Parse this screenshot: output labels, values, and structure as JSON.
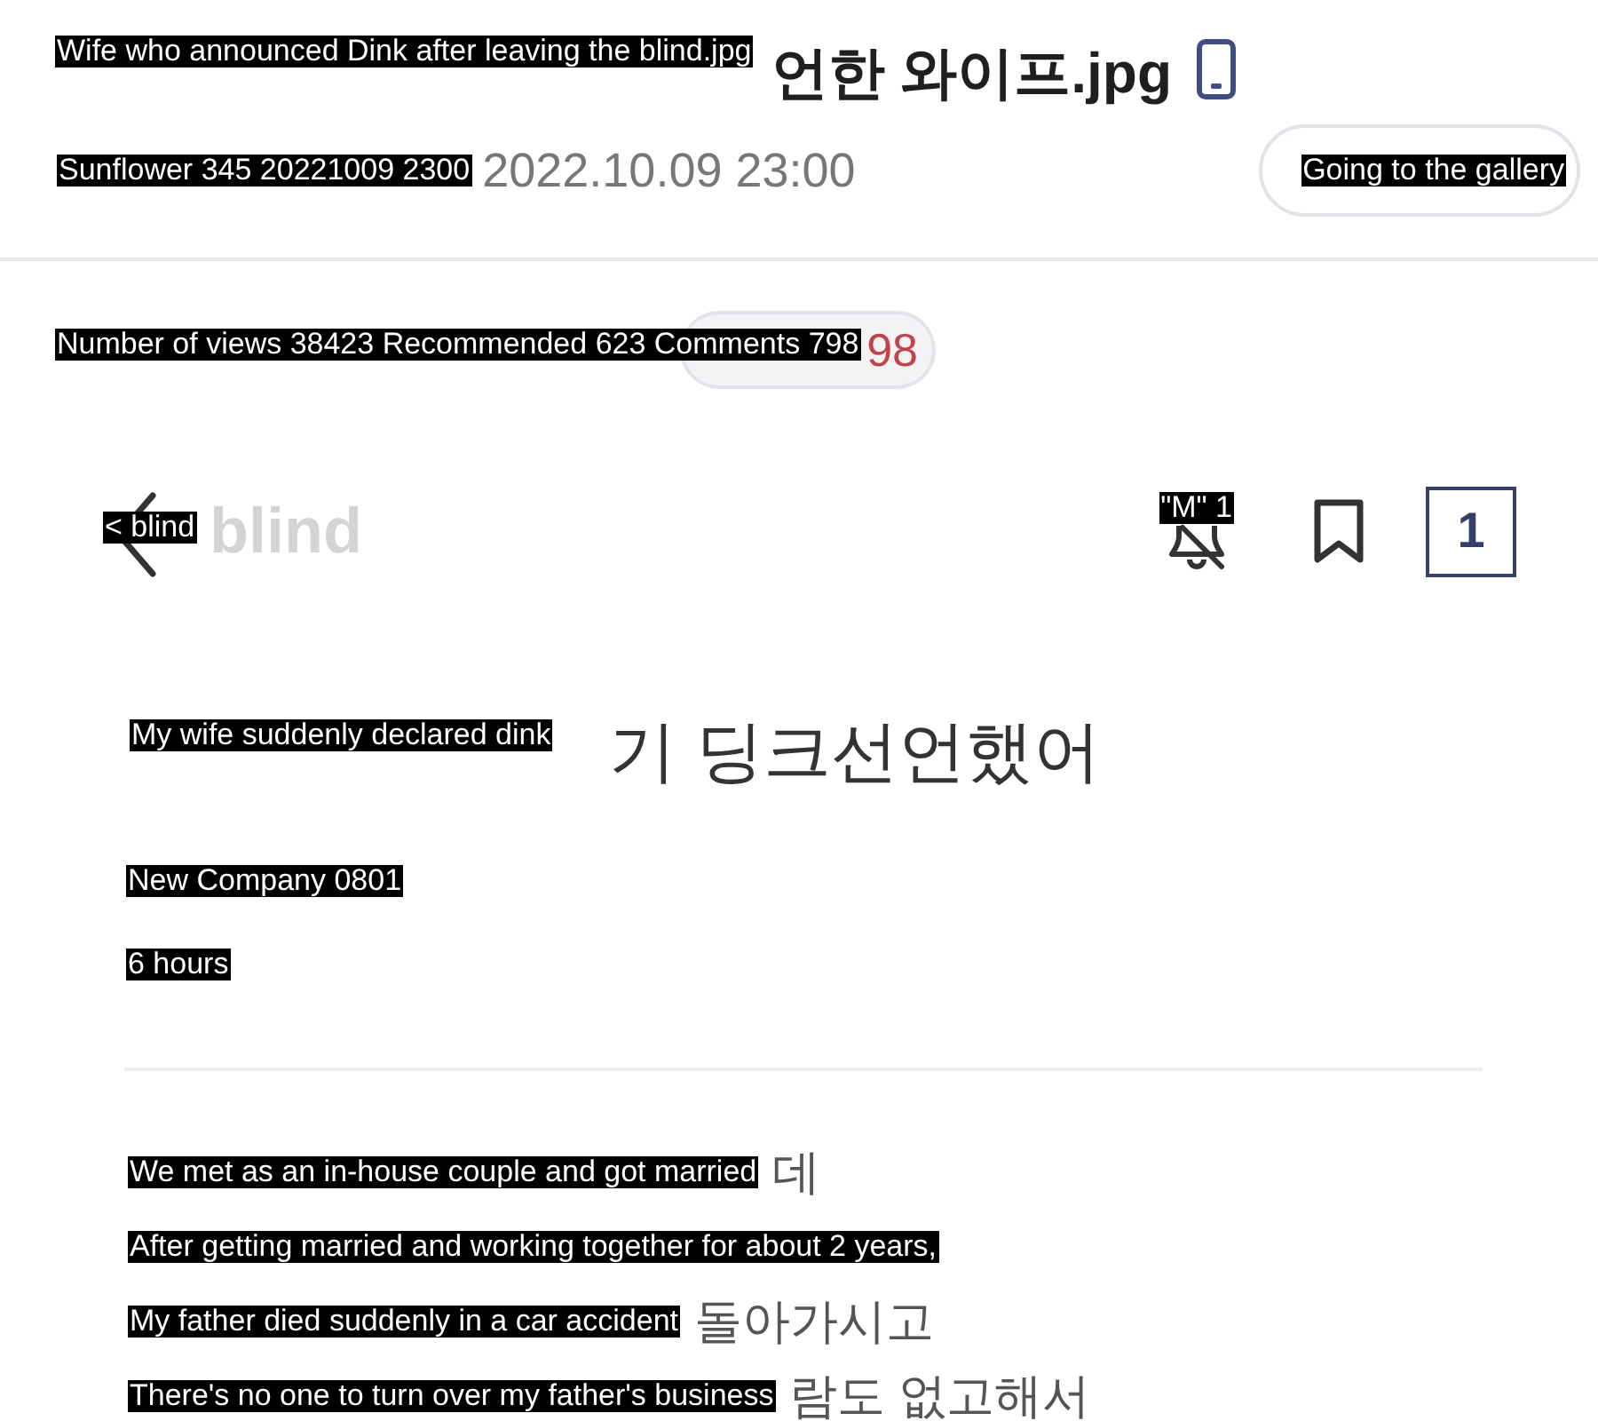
{
  "post_header": {
    "title": {
      "translation": "Wife who announced Dink after leaving the blind.jpg",
      "shown": "언한 와이프.jpg"
    },
    "byline": {
      "translation": "Sunflower 345 20221009 2300",
      "date": "2022.10.09 23:00"
    },
    "gallery_button": "Going to the gallery",
    "stats": {
      "translation": "Number of views 38423 Recommended 623 Comments 798",
      "comments_shown": "98"
    }
  },
  "blind_post": {
    "nav": {
      "back": "< blind",
      "logo": "blind",
      "notifications": "\"M\" 1",
      "tab_count": "1"
    },
    "title": {
      "translation": "My wife suddenly declared dink",
      "shown": "기 딩크선언했어"
    },
    "author": "New Company 0801",
    "time": "6 hours",
    "body": [
      {
        "translation": "We met as an in-house couple and got married",
        "shown": "데"
      },
      {
        "translation": "After getting married and working together for about 2 years,"
      },
      {
        "translation": "My father died suddenly in a car accident",
        "shown": "돌아가시고"
      },
      {
        "translation": "There's no one to turn over my father's business",
        "shown": "람도 없고해서"
      }
    ]
  }
}
